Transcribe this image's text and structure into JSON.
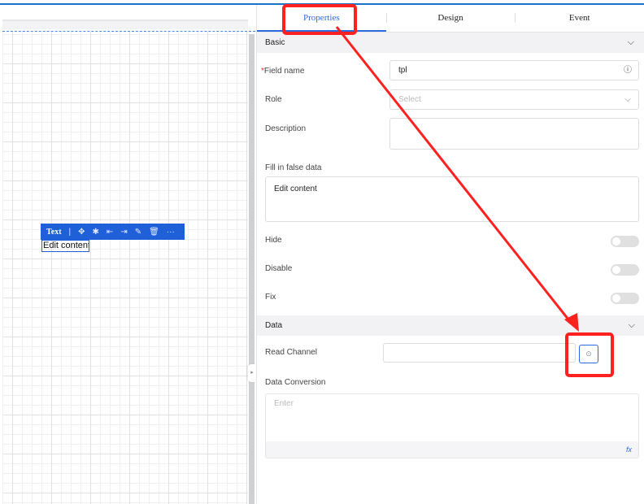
{
  "canvas": {
    "toolbar": {
      "type_label": "Text",
      "icons": [
        "move-icon",
        "bug-icon",
        "align-left-icon",
        "align-right-icon",
        "edit-icon",
        "delete-icon",
        "more-icon"
      ]
    },
    "selected_text": "Edit content"
  },
  "tabs": [
    {
      "label": "Properties",
      "active": true
    },
    {
      "label": "Design"
    },
    {
      "label": "Event"
    }
  ],
  "basic": {
    "title": "Basic",
    "field_name_label": "Field name",
    "field_name_value": "tpl",
    "role_label": "Role",
    "role_placeholder": "Select",
    "description_label": "Description",
    "fill_label": "Fill in false data",
    "fill_value": "Edit content",
    "hide_label": "Hide",
    "disable_label": "Disable",
    "fix_label": "Fix"
  },
  "data": {
    "title": "Data",
    "read_channel_label": "Read Channel",
    "conversion_label": "Data Conversion",
    "conversion_placeholder": "Enter",
    "fx_label": "fx"
  },
  "colors": {
    "accent": "#2b6be0",
    "annotation": "#ff2020"
  }
}
